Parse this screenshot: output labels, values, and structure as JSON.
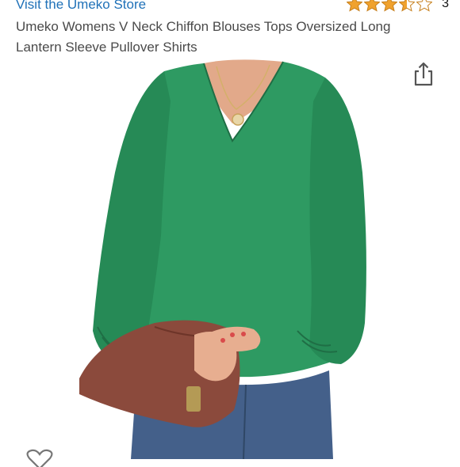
{
  "header": {
    "store_link": "Visit the Umeko Store",
    "rating": {
      "stars": 3.5,
      "max": 5,
      "count_label": "3"
    }
  },
  "product": {
    "title": "Umeko Womens V Neck Chiffon Blouses Tops Oversized Long Lantern Sleeve Pullover Shirts",
    "image_alt": "Green V-neck chiffon blouse with lantern sleeves, worn with jeans and a brown clutch"
  },
  "icons": {
    "share": "share-icon",
    "wishlist": "heart-icon",
    "star": "star-icon"
  },
  "colors": {
    "link": "#1f71b8",
    "star": "#f0a22e",
    "blouse": "#2e9a62"
  }
}
